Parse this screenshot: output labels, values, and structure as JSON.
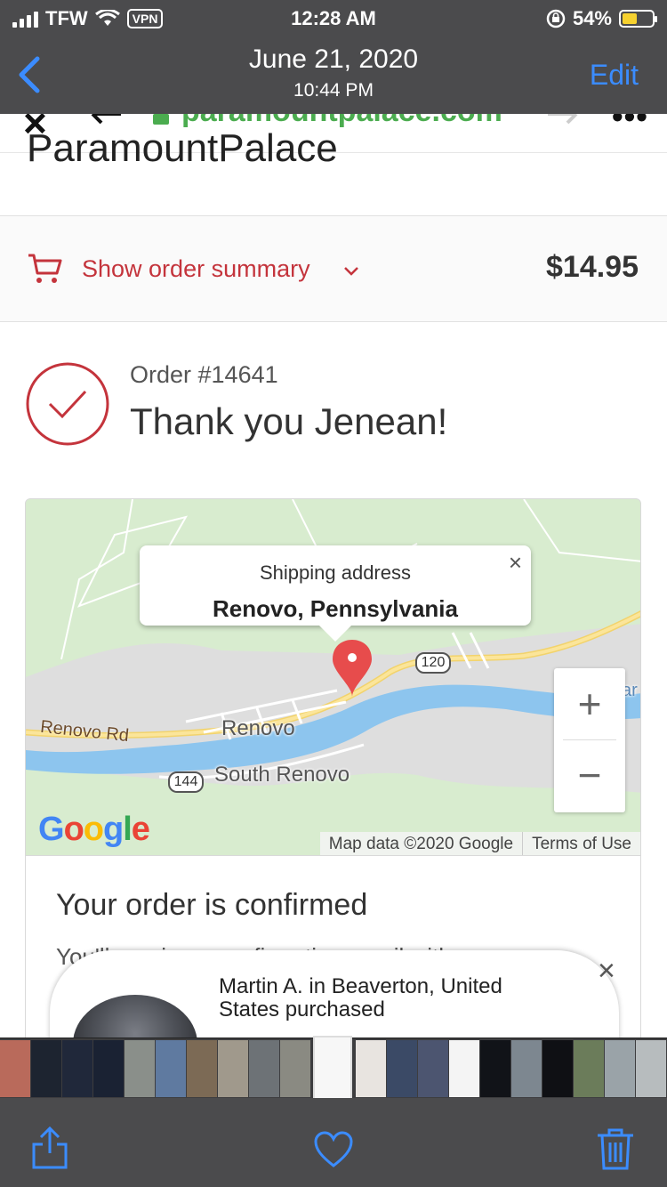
{
  "status_bar": {
    "carrier": "TFW",
    "vpn": "VPN",
    "time": "12:28 AM",
    "battery": "54%",
    "battery_color": "#f6d12f"
  },
  "photo_nav": {
    "back_icon": "chevron-left-icon",
    "date": "June 21, 2020",
    "time": "10:44 PM",
    "edit_label": "Edit",
    "accent": "#3b8cff"
  },
  "browser": {
    "url": "paramountpalace.com",
    "store_name": "ParamountPalace"
  },
  "order_summary": {
    "label": "Show order summary",
    "total": "$14.95",
    "accent": "#c4343c"
  },
  "confirmation": {
    "order_number": "Order #14641",
    "thank_you": "Thank you Jenean!"
  },
  "map": {
    "popup_title": "Shipping address",
    "popup_address": "Renovo, Pennsylvania",
    "popup_close": "×",
    "places": [
      "Renovo",
      "South Renovo"
    ],
    "road_label": "Renovo Rd",
    "route_shields": [
      "120",
      "144"
    ],
    "edge_label": "ar",
    "zoom_in": "+",
    "zoom_out": "−",
    "logo": "Google",
    "map_data": "Map data ©2020 Google",
    "terms": "Terms of Use"
  },
  "order_confirmed": {
    "title": "Your order is confirmed",
    "text": "You'll receive a confirmation email with your"
  },
  "social_proof": {
    "text": "Martin A. in Beaverton, United States purchased",
    "close": "×"
  },
  "bottom_toolbar": {
    "share_icon": "share-icon",
    "favorite_icon": "heart-icon",
    "delete_icon": "trash-icon"
  }
}
